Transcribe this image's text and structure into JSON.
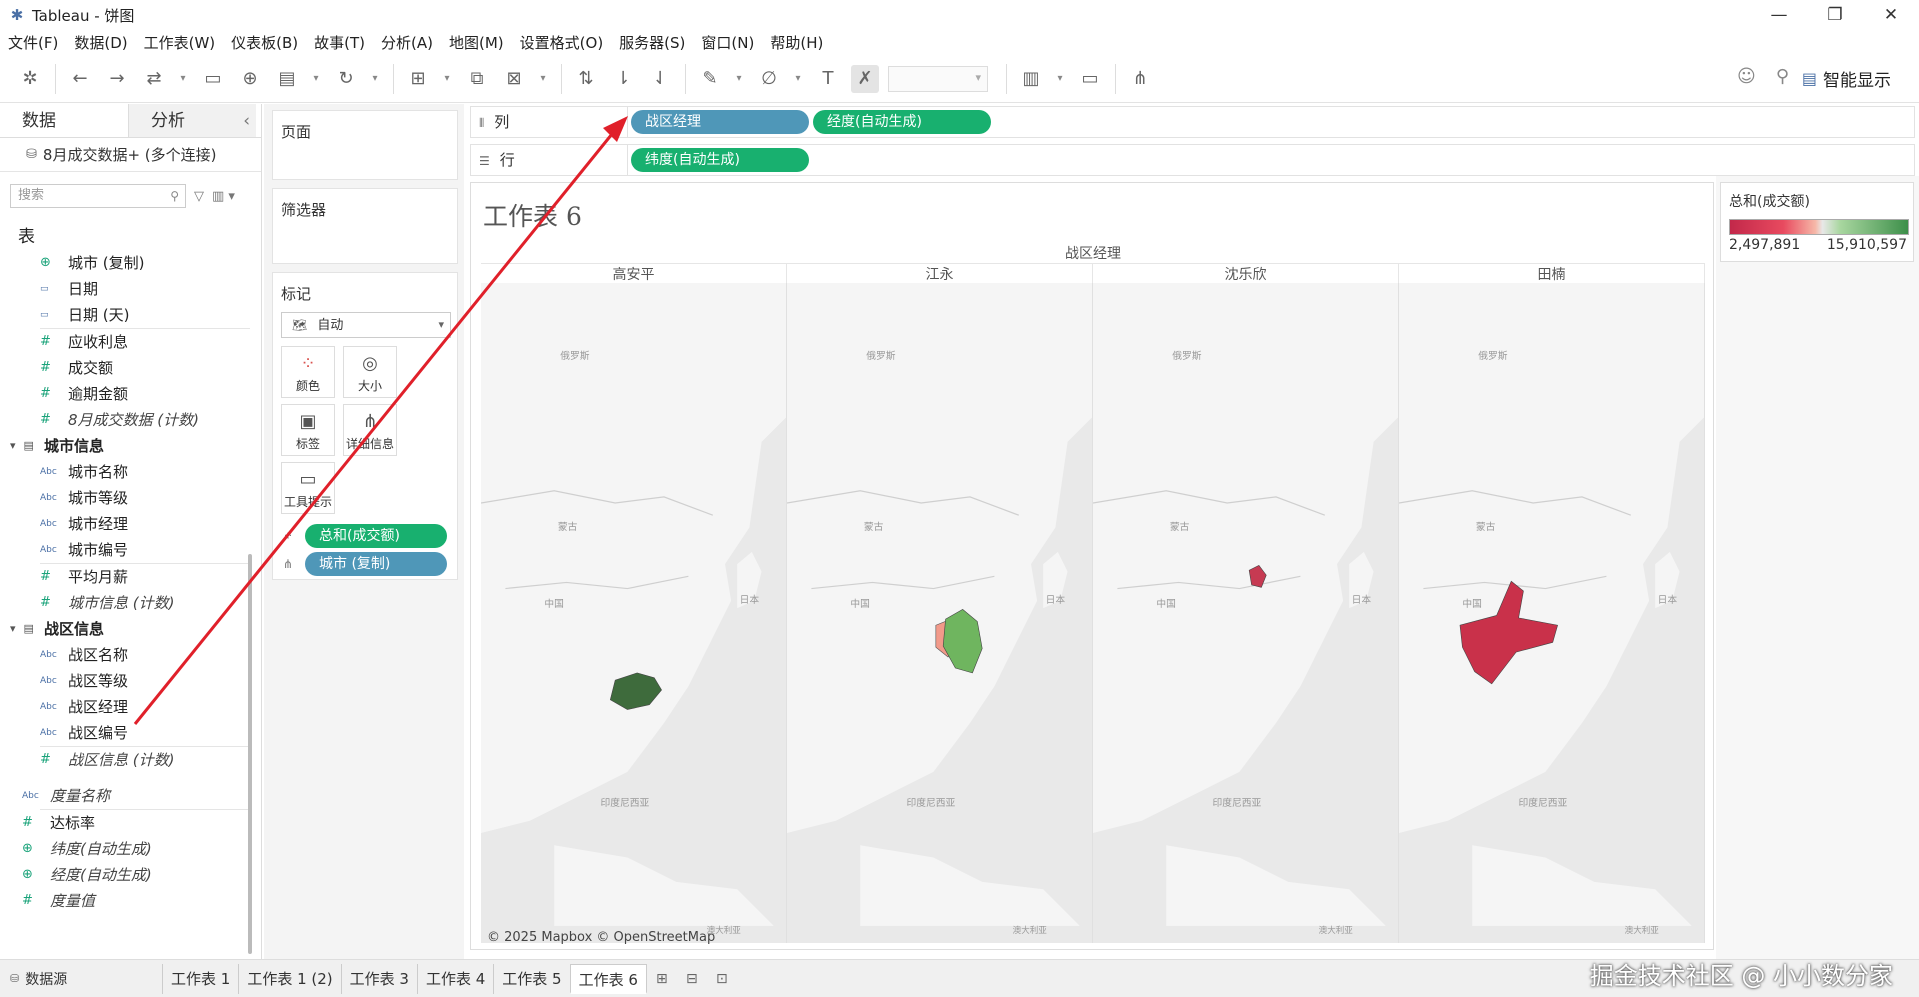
{
  "window": {
    "title": "Tableau - 饼图",
    "minimize": "—",
    "restore": "❐",
    "close": "✕"
  },
  "menu": [
    "文件(F)",
    "数据(D)",
    "工作表(W)",
    "仪表板(B)",
    "故事(T)",
    "分析(A)",
    "地图(M)",
    "设置格式(O)",
    "服务器(S)",
    "窗口(N)",
    "帮助(H)"
  ],
  "toolbar": {
    "smart_show": "智能显示"
  },
  "left_pane": {
    "tabs": [
      "数据",
      "分析"
    ],
    "source": "8月成交数据+ (多个连接)",
    "search_placeholder": "搜索",
    "tables_header": "表",
    "top_items": [
      {
        "icon": "globe",
        "label": "城市 (复制)",
        "italic": false
      },
      {
        "icon": "date",
        "label": "日期",
        "italic": false
      },
      {
        "icon": "date",
        "label": "日期 (天)",
        "italic": false
      },
      {
        "icon": "num",
        "label": "应收利息",
        "italic": false
      },
      {
        "icon": "num",
        "label": "成交额",
        "italic": false
      },
      {
        "icon": "num",
        "label": "逾期金额",
        "italic": false
      },
      {
        "icon": "num",
        "label": "8月成交数据 (计数)",
        "italic": true
      }
    ],
    "group1": {
      "title": "城市信息",
      "items": [
        {
          "icon": "abc",
          "label": "城市名称",
          "italic": false
        },
        {
          "icon": "abc",
          "label": "城市等级",
          "italic": false
        },
        {
          "icon": "abc",
          "label": "城市经理",
          "italic": false
        },
        {
          "icon": "abc",
          "label": "城市编号",
          "italic": false
        },
        {
          "icon": "num",
          "label": "平均月薪",
          "italic": false
        },
        {
          "icon": "num",
          "label": "城市信息 (计数)",
          "italic": true
        }
      ]
    },
    "group2": {
      "title": "战区信息",
      "items": [
        {
          "icon": "abc",
          "label": "战区名称",
          "italic": false
        },
        {
          "icon": "abc",
          "label": "战区等级",
          "italic": false
        },
        {
          "icon": "abc",
          "label": "战区经理",
          "italic": false
        },
        {
          "icon": "abc",
          "label": "战区编号",
          "italic": false
        },
        {
          "icon": "num",
          "label": "战区信息 (计数)",
          "italic": true
        }
      ]
    },
    "bottom_items": [
      {
        "icon": "abc",
        "label": "度量名称",
        "italic": true
      },
      {
        "icon": "num",
        "label": "达标率",
        "italic": false
      },
      {
        "icon": "globe",
        "label": "纬度(自动生成)",
        "italic": true
      },
      {
        "icon": "globe",
        "label": "经度(自动生成)",
        "italic": true
      },
      {
        "icon": "num",
        "label": "度量值",
        "italic": true
      }
    ]
  },
  "cards": {
    "pages": "页面",
    "filters": "筛选器",
    "marks": "标记",
    "mark_type": "自动",
    "mark_buttons": [
      "颜色",
      "大小",
      "标签",
      "详细信息",
      "工具提示"
    ],
    "mark_pills": [
      "总和(成交额)",
      "城市 (复制)"
    ]
  },
  "shelves": {
    "columns_label": "列",
    "rows_label": "行",
    "columns_pills": [
      "战区经理",
      "经度(自动生成)"
    ],
    "rows_pills": [
      "纬度(自动生成)"
    ]
  },
  "viz": {
    "title": "工作表 6",
    "header": "战区经理",
    "columns": [
      "高安平",
      "江永",
      "沈乐欣",
      "田楠"
    ],
    "map_labels": [
      "俄罗斯",
      "蒙古",
      "中国",
      "日本",
      "印度尼西亚",
      "澳大利亚"
    ],
    "credit": "© 2025 Mapbox © OpenStreetMap"
  },
  "legend": {
    "title": "总和(成交额)",
    "min": "2,497,891",
    "max": "15,910,597"
  },
  "bottom": {
    "source": "数据源",
    "tabs": [
      "工作表 1",
      "工作表 1 (2)",
      "工作表 3",
      "工作表 4",
      "工作表 5",
      "工作表 6"
    ],
    "active_index": 5,
    "watermark": "掘金技术社区 @ 小小数分家"
  },
  "colors": {
    "green_pill": "#18b06f",
    "blue_pill": "#4f97b8",
    "arrow": "#e0202a"
  }
}
